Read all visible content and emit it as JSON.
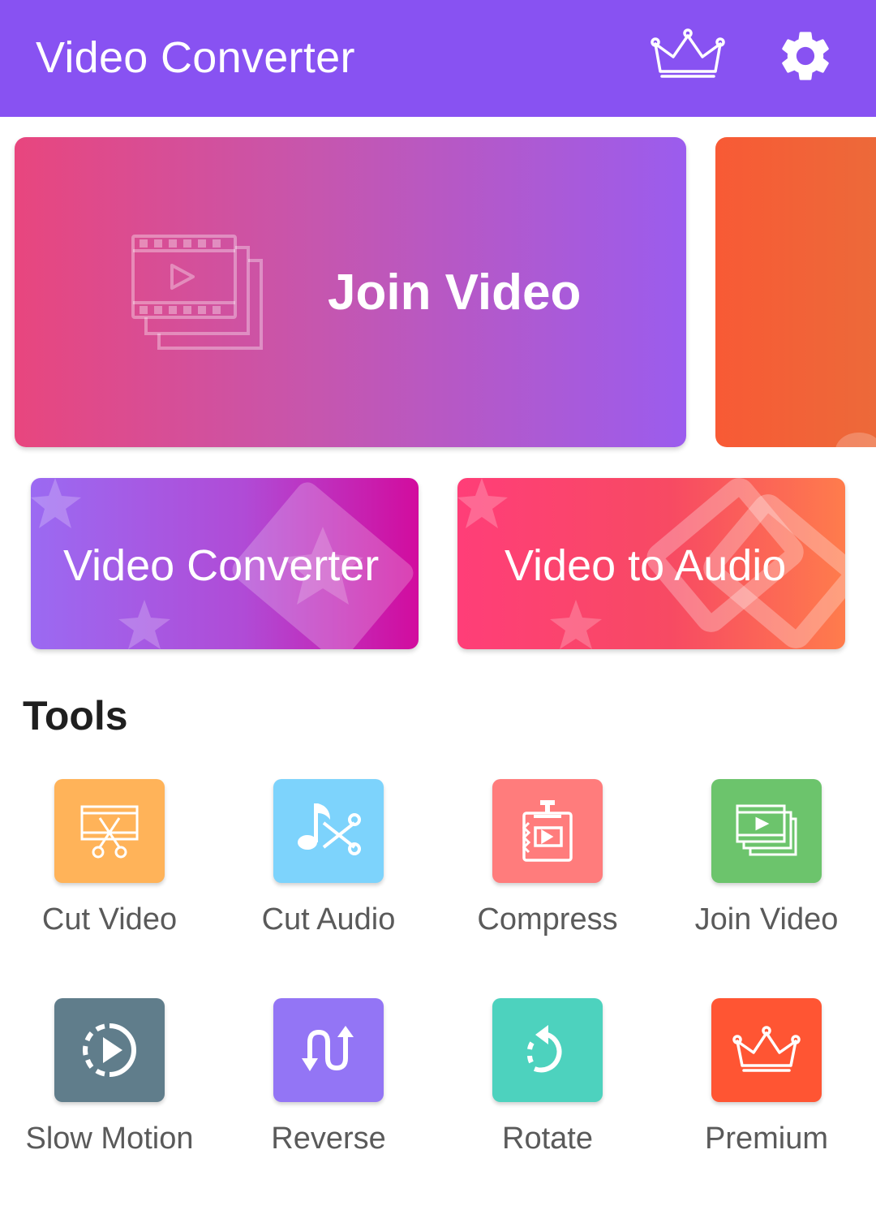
{
  "app_bar": {
    "title": "Video Converter",
    "background": "#8852F2",
    "premium_icon": "crown-icon",
    "settings_icon": "gear-icon"
  },
  "banner": {
    "label": "Join Video",
    "icon": "film-stack-icon"
  },
  "feature_cards": {
    "video_converter": {
      "label": "Video Converter"
    },
    "video_to_audio": {
      "label": "Video to Audio"
    }
  },
  "tools_section": {
    "title": "Tools",
    "items": [
      {
        "label": "Cut Video",
        "icon": "cut-video-icon",
        "color": "#FFB359"
      },
      {
        "label": "Cut Audio",
        "icon": "cut-audio-icon",
        "color": "#7DD3FC"
      },
      {
        "label": "Compress",
        "icon": "compress-icon",
        "color": "#FF7C7C"
      },
      {
        "label": "Join Video",
        "icon": "join-video-icon",
        "color": "#6CC46C"
      },
      {
        "label": "Slow Motion",
        "icon": "slow-motion-icon",
        "color": "#607D8B"
      },
      {
        "label": "Reverse",
        "icon": "reverse-icon",
        "color": "#9375F5"
      },
      {
        "label": "Rotate",
        "icon": "rotate-icon",
        "color": "#4DD2BE"
      },
      {
        "label": "Premium",
        "icon": "premium-crown-icon",
        "color": "#FF5533"
      }
    ]
  }
}
